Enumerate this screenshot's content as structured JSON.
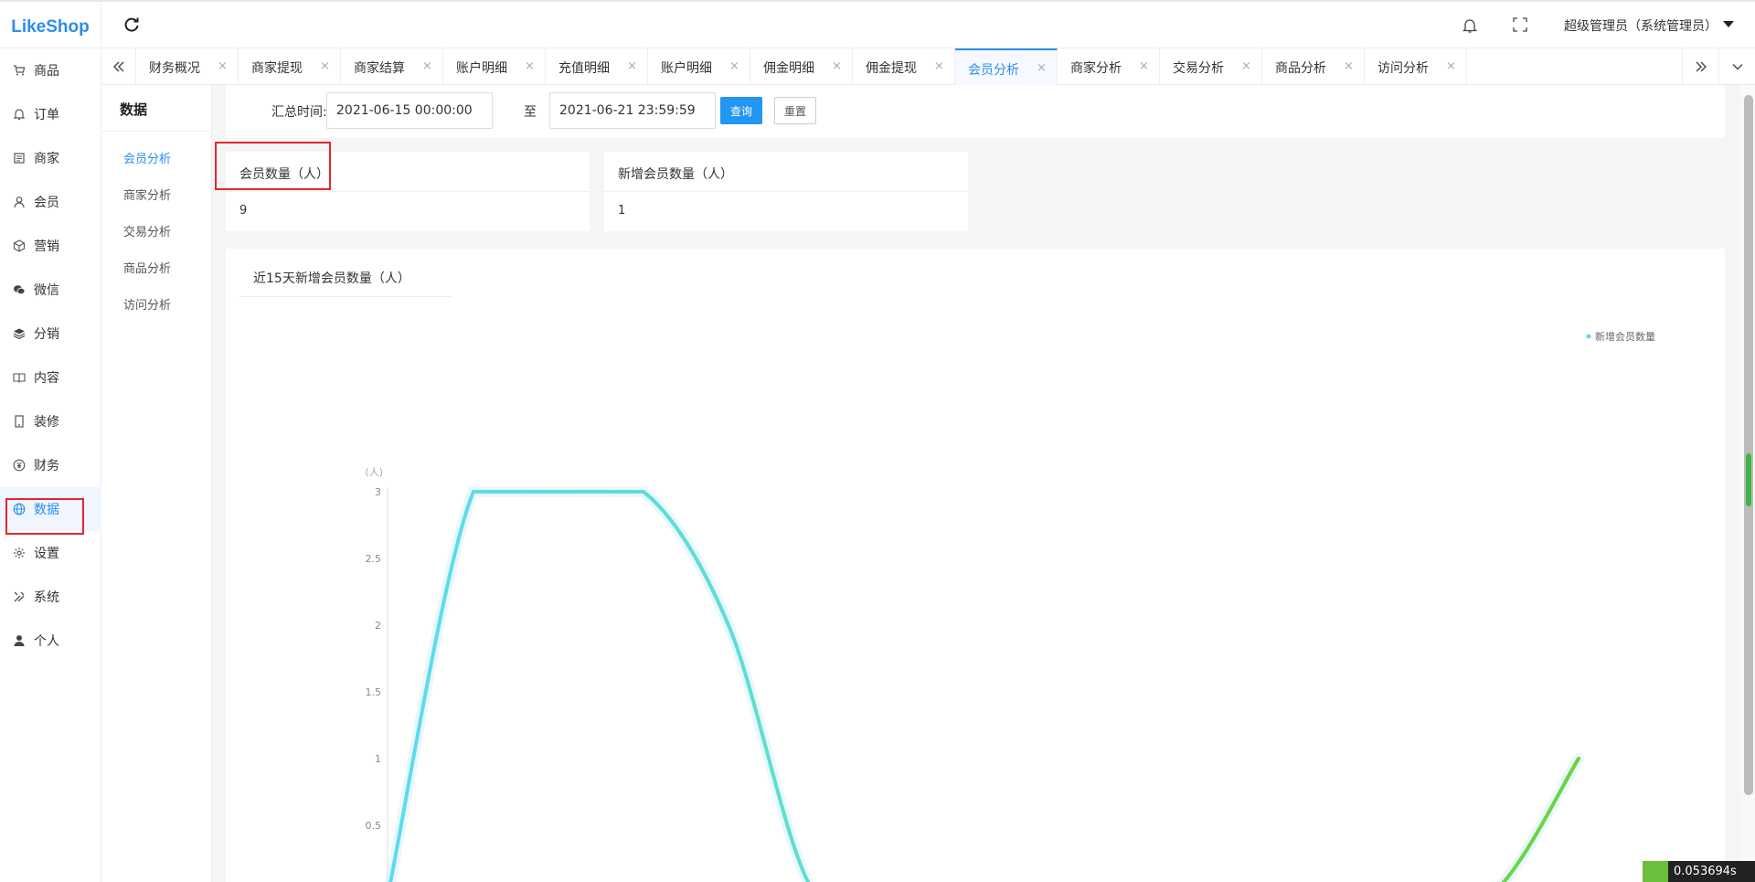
{
  "header": {
    "logo": "LikeShop",
    "user_name": "超级管理员（系统管理员）"
  },
  "sidebar": {
    "items": [
      {
        "label": "商品",
        "icon": "cart-icon"
      },
      {
        "label": "订单",
        "icon": "bell-icon"
      },
      {
        "label": "商家",
        "icon": "store-icon"
      },
      {
        "label": "会员",
        "icon": "person-icon"
      },
      {
        "label": "营销",
        "icon": "cube-icon"
      },
      {
        "label": "微信",
        "icon": "wechat-icon"
      },
      {
        "label": "分销",
        "icon": "layers-icon"
      },
      {
        "label": "内容",
        "icon": "book-icon"
      },
      {
        "label": "装修",
        "icon": "tablet-icon"
      },
      {
        "label": "财务",
        "icon": "yen-icon"
      },
      {
        "label": "数据",
        "icon": "globe-icon"
      },
      {
        "label": "设置",
        "icon": "gear-icon"
      },
      {
        "label": "系统",
        "icon": "tools-icon"
      },
      {
        "label": "个人",
        "icon": "user-icon"
      }
    ],
    "active": "数据"
  },
  "tabs": [
    {
      "label": "财务概况",
      "close": "×"
    },
    {
      "label": "商家提现",
      "close": "×"
    },
    {
      "label": "商家结算",
      "close": "×"
    },
    {
      "label": "账户明细",
      "close": "×"
    },
    {
      "label": "充值明细",
      "close": "×"
    },
    {
      "label": "账户明细",
      "close": "×"
    },
    {
      "label": "佣金明细",
      "close": "×"
    },
    {
      "label": "佣金提现",
      "close": "×"
    },
    {
      "label": "会员分析",
      "close": "×"
    },
    {
      "label": "商家分析",
      "close": "×"
    },
    {
      "label": "交易分析",
      "close": "×"
    },
    {
      "label": "商品分析",
      "close": "×"
    },
    {
      "label": "访问分析",
      "close": "×"
    }
  ],
  "active_tab": "会员分析",
  "subnav": {
    "title": "数据",
    "items": [
      "会员分析",
      "商家分析",
      "交易分析",
      "商品分析",
      "访问分析"
    ],
    "active": "会员分析"
  },
  "filter": {
    "label": "汇总时间:",
    "start": "2021-06-15 00:00:00",
    "separator": "至",
    "end": "2021-06-21 23:59:59",
    "query_button": "查询",
    "reset_button": "重置"
  },
  "cards": [
    {
      "title": "会员数量（人）",
      "value": "9"
    },
    {
      "title": "新增会员数量（人）",
      "value": "1"
    }
  ],
  "chart_panel_title": "近15天新增会员数量（人）",
  "chart_data": {
    "type": "line",
    "title": "",
    "ylabel": "(人)",
    "ylim": [
      0,
      3
    ],
    "yticks": [
      "0.5",
      "1",
      "1.5",
      "2",
      "2.5",
      "3"
    ],
    "series": [
      {
        "name": "新增会员数量",
        "values": [
          0,
          3,
          3,
          3,
          2,
          0,
          0,
          0,
          0,
          0,
          0,
          0,
          0,
          0,
          1
        ]
      }
    ],
    "legend": "top-right",
    "colors": {
      "start": "#5fd9f0",
      "end": "#6ad43e"
    }
  },
  "timer": "0.053694s"
}
